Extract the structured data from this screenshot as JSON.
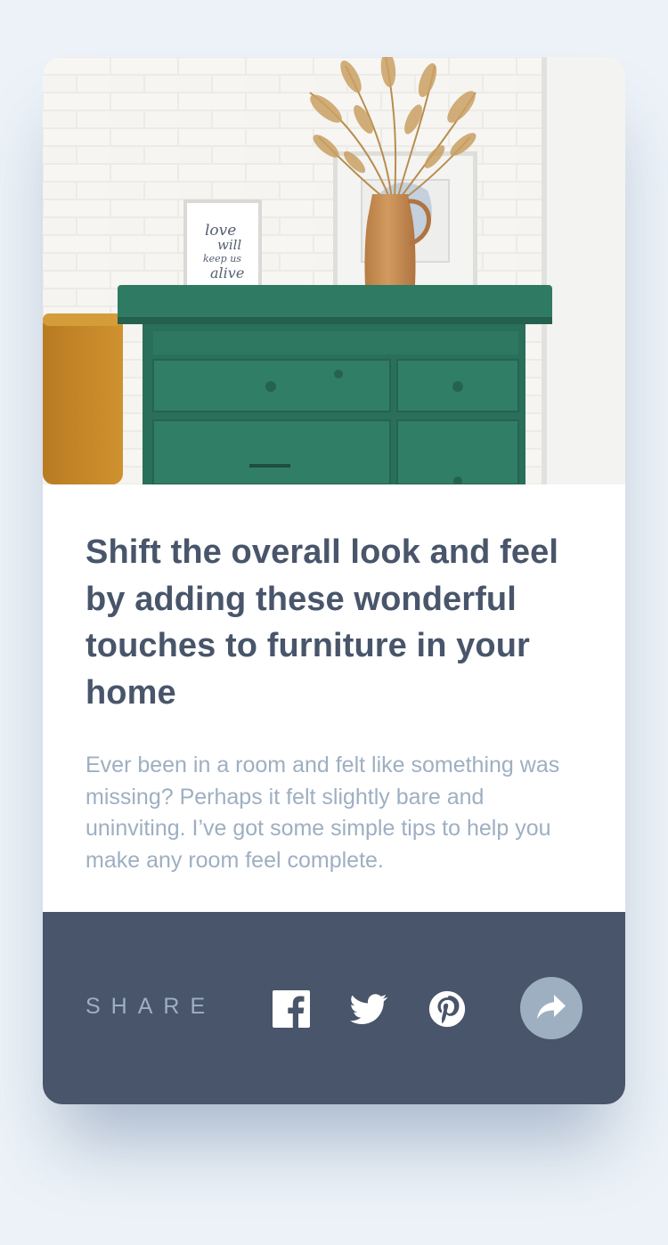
{
  "article": {
    "image_alt": "Green wooden drawers with a vase and framed prints against a white brick wall",
    "frame_text": [
      "love",
      "will",
      "keep us",
      "alive"
    ],
    "title": "Shift the overall look and feel by adding these wonderful touches to furniture in your home",
    "description": "Ever been in a room and felt like something was missing? Perhaps it felt slightly bare and uninviting. I’ve got some simple tips to help you make any room feel complete."
  },
  "share": {
    "label": "SHARE",
    "icons": [
      "facebook-icon",
      "twitter-icon",
      "pinterest-icon",
      "share-arrow-icon"
    ]
  },
  "colors": {
    "page_bg": "#ecf2f8",
    "title": "#48556a",
    "text_muted": "#9eafc2",
    "share_bar": "#48556a",
    "dresser_green": "#2f7a62"
  }
}
